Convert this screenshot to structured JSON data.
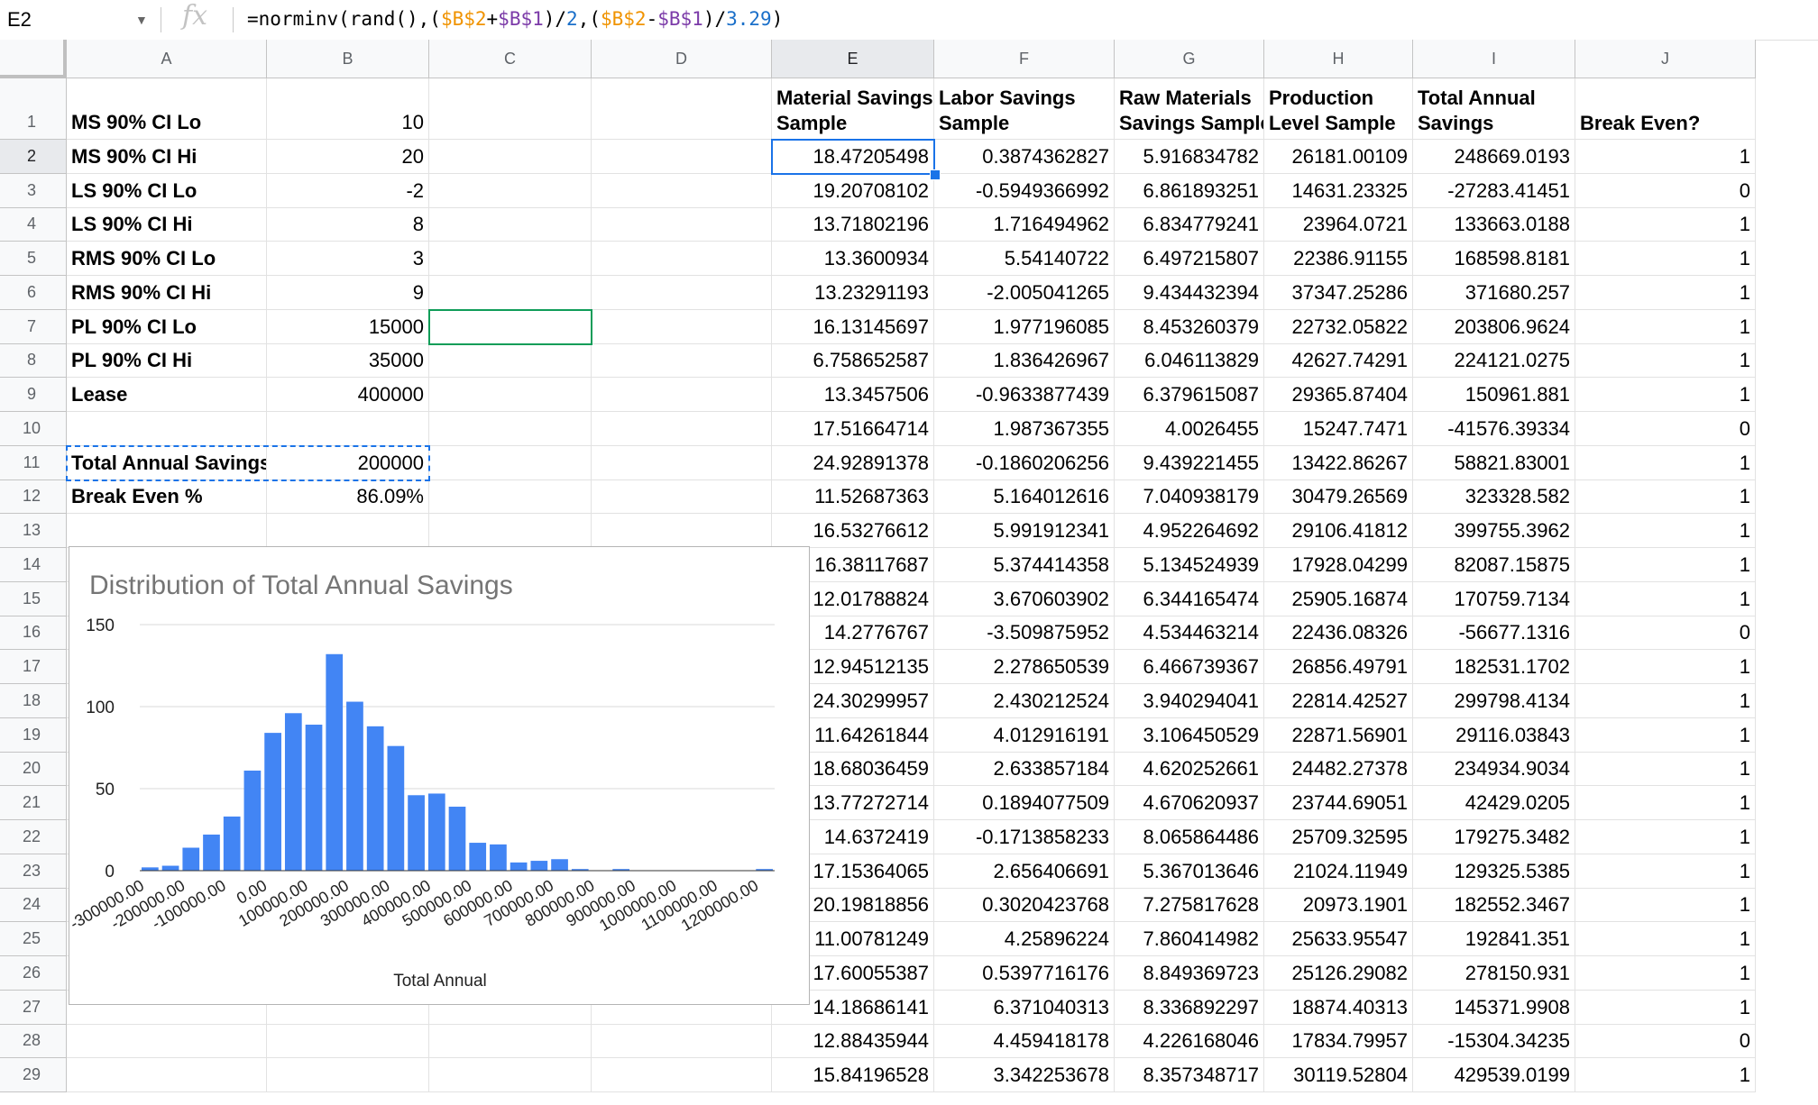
{
  "formula_bar": {
    "name_box": "E2",
    "fx_icon": "fx",
    "formula_parts": [
      {
        "text": "=norminv(rand(),(",
        "color": "t"
      },
      {
        "text": "$B$2",
        "color": "o"
      },
      {
        "text": "+",
        "color": "t"
      },
      {
        "text": "$B$1",
        "color": "p"
      },
      {
        "text": ")/",
        "color": "t"
      },
      {
        "text": "2",
        "color": "b"
      },
      {
        "text": ",(",
        "color": "t"
      },
      {
        "text": "$B$2",
        "color": "o"
      },
      {
        "text": "-",
        "color": "t"
      },
      {
        "text": "$B$1",
        "color": "p"
      },
      {
        "text": ")/",
        "color": "t"
      },
      {
        "text": "3.29",
        "color": "b"
      },
      {
        "text": ")",
        "color": "t"
      }
    ]
  },
  "columns": [
    "A",
    "B",
    "C",
    "D",
    "E",
    "F",
    "G",
    "H",
    "I",
    "J"
  ],
  "rows": [
    "1",
    "2",
    "3",
    "4",
    "5",
    "6",
    "7",
    "8",
    "9",
    "10",
    "11",
    "12",
    "13",
    "14",
    "15",
    "16",
    "17",
    "18",
    "19",
    "20",
    "21",
    "22",
    "23",
    "24",
    "25",
    "26",
    "27",
    "28",
    "29"
  ],
  "inputs": [
    [
      "MS 90% CI Lo",
      "10"
    ],
    [
      "MS 90% CI Hi",
      "20"
    ],
    [
      "LS 90% CI Lo",
      "-2"
    ],
    [
      "LS 90% CI Hi",
      "8"
    ],
    [
      "RMS 90% CI Lo",
      "3"
    ],
    [
      "RMS 90% CI Hi",
      "9"
    ],
    [
      "PL 90% CI Lo",
      "15000"
    ],
    [
      "PL 90% CI Hi",
      "35000"
    ],
    [
      "Lease",
      "400000"
    ],
    [
      "",
      ""
    ],
    [
      "Total Annual Savings",
      "200000"
    ],
    [
      "Break Even %",
      "86.09%"
    ]
  ],
  "sample_headers": [
    [
      "Material Savings",
      "Sample"
    ],
    [
      "Labor Savings",
      "Sample"
    ],
    [
      "Raw Materials",
      "Savings Sample"
    ],
    [
      "Production",
      "Level Sample"
    ],
    [
      "Total Annual",
      "Savings"
    ],
    [
      "",
      "Break Even?"
    ]
  ],
  "samples": [
    [
      "18.47205498",
      "0.3874362827",
      "5.916834782",
      "26181.00109",
      "248669.0193",
      "1"
    ],
    [
      "19.20708102",
      "-0.5949366992",
      "6.861893251",
      "14631.23325",
      "-27283.41451",
      "0"
    ],
    [
      "13.71802196",
      "1.716494962",
      "6.834779241",
      "23964.0721",
      "133663.0188",
      "1"
    ],
    [
      "13.3600934",
      "5.54140722",
      "6.497215807",
      "22386.91155",
      "168598.8181",
      "1"
    ],
    [
      "13.23291193",
      "-2.005041265",
      "9.434432394",
      "37347.25286",
      "371680.257",
      "1"
    ],
    [
      "16.13145697",
      "1.977196085",
      "8.453260379",
      "22732.05822",
      "203806.9624",
      "1"
    ],
    [
      "6.758652587",
      "1.836426967",
      "6.046113829",
      "42627.74291",
      "224121.0275",
      "1"
    ],
    [
      "13.3457506",
      "-0.9633877439",
      "6.379615087",
      "29365.87404",
      "150961.881",
      "1"
    ],
    [
      "17.51664714",
      "1.987367355",
      "4.0026455",
      "15247.7471",
      "-41576.39334",
      "0"
    ],
    [
      "24.92891378",
      "-0.1860206256",
      "9.439221455",
      "13422.86267",
      "58821.83001",
      "1"
    ],
    [
      "11.52687363",
      "5.164012616",
      "7.040938179",
      "30479.26569",
      "323328.582",
      "1"
    ],
    [
      "16.53276612",
      "5.991912341",
      "4.952264692",
      "29106.41812",
      "399755.3962",
      "1"
    ],
    [
      "16.38117687",
      "5.374414358",
      "5.134524939",
      "17928.04299",
      "82087.15875",
      "1"
    ],
    [
      "12.01788824",
      "3.670603902",
      "6.344165474",
      "25905.16874",
      "170759.7134",
      "1"
    ],
    [
      "14.2776767",
      "-3.509875952",
      "4.534463214",
      "22436.08326",
      "-56677.1316",
      "0"
    ],
    [
      "12.94512135",
      "2.278650539",
      "6.466739367",
      "26856.49791",
      "182531.1702",
      "1"
    ],
    [
      "24.30299957",
      "2.430212524",
      "3.940294041",
      "22814.42527",
      "299798.4134",
      "1"
    ],
    [
      "11.64261844",
      "4.012916191",
      "3.106450529",
      "22871.56901",
      "29116.03843",
      "1"
    ],
    [
      "18.68036459",
      "2.633857184",
      "4.620252661",
      "24482.27378",
      "234934.9034",
      "1"
    ],
    [
      "13.77272714",
      "0.1894077509",
      "4.670620937",
      "23744.69051",
      "42429.0205",
      "1"
    ],
    [
      "14.6372419",
      "-0.1713858233",
      "8.065864486",
      "25709.32595",
      "179275.3482",
      "1"
    ],
    [
      "17.15364065",
      "2.656406691",
      "5.367013646",
      "21024.11949",
      "129325.5385",
      "1"
    ],
    [
      "20.19818856",
      "0.3020423768",
      "7.275817628",
      "20973.1901",
      "182552.3467",
      "1"
    ],
    [
      "11.00781249",
      "4.25896224",
      "7.860414982",
      "25633.95547",
      "192841.351",
      "1"
    ],
    [
      "17.60055387",
      "0.5397716176",
      "8.849369723",
      "25126.29082",
      "278150.931",
      "1"
    ],
    [
      "14.18686141",
      "6.371040313",
      "8.336892297",
      "18874.40313",
      "145371.9908",
      "1"
    ],
    [
      "12.88435944",
      "4.459418178",
      "4.226168046",
      "17834.79957",
      "-15304.34235",
      "0"
    ],
    [
      "15.84196528",
      "3.342253678",
      "8.357348717",
      "30119.52804",
      "429539.0199",
      "1"
    ]
  ],
  "chart_data": {
    "type": "bar",
    "title": "Distribution of Total Annual Savings",
    "xlabel": "Total Annual",
    "ylabel": "",
    "ylim": [
      0,
      150
    ],
    "yticks": [
      "0",
      "50",
      "100",
      "150"
    ],
    "tick_labels": [
      "-300000.00",
      "-200000.00",
      "-100000.00",
      "0.00",
      "100000.00",
      "200000.00",
      "300000.00",
      "400000.00",
      "500000.00",
      "600000.00",
      "700000.00",
      "800000.00",
      "900000.00",
      "1000000.00",
      "1100000.00",
      "1200000.00"
    ],
    "bin_start": -300000,
    "bin_width": 50000,
    "values": [
      2,
      3,
      14,
      22,
      33,
      61,
      84,
      96,
      89,
      132,
      103,
      88,
      76,
      46,
      47,
      39,
      17,
      16,
      5,
      6,
      7,
      1,
      0,
      1,
      0,
      0,
      0,
      0,
      0,
      0,
      1
    ],
    "bar_color": "#4285f4",
    "grid": true,
    "legend": "none"
  }
}
